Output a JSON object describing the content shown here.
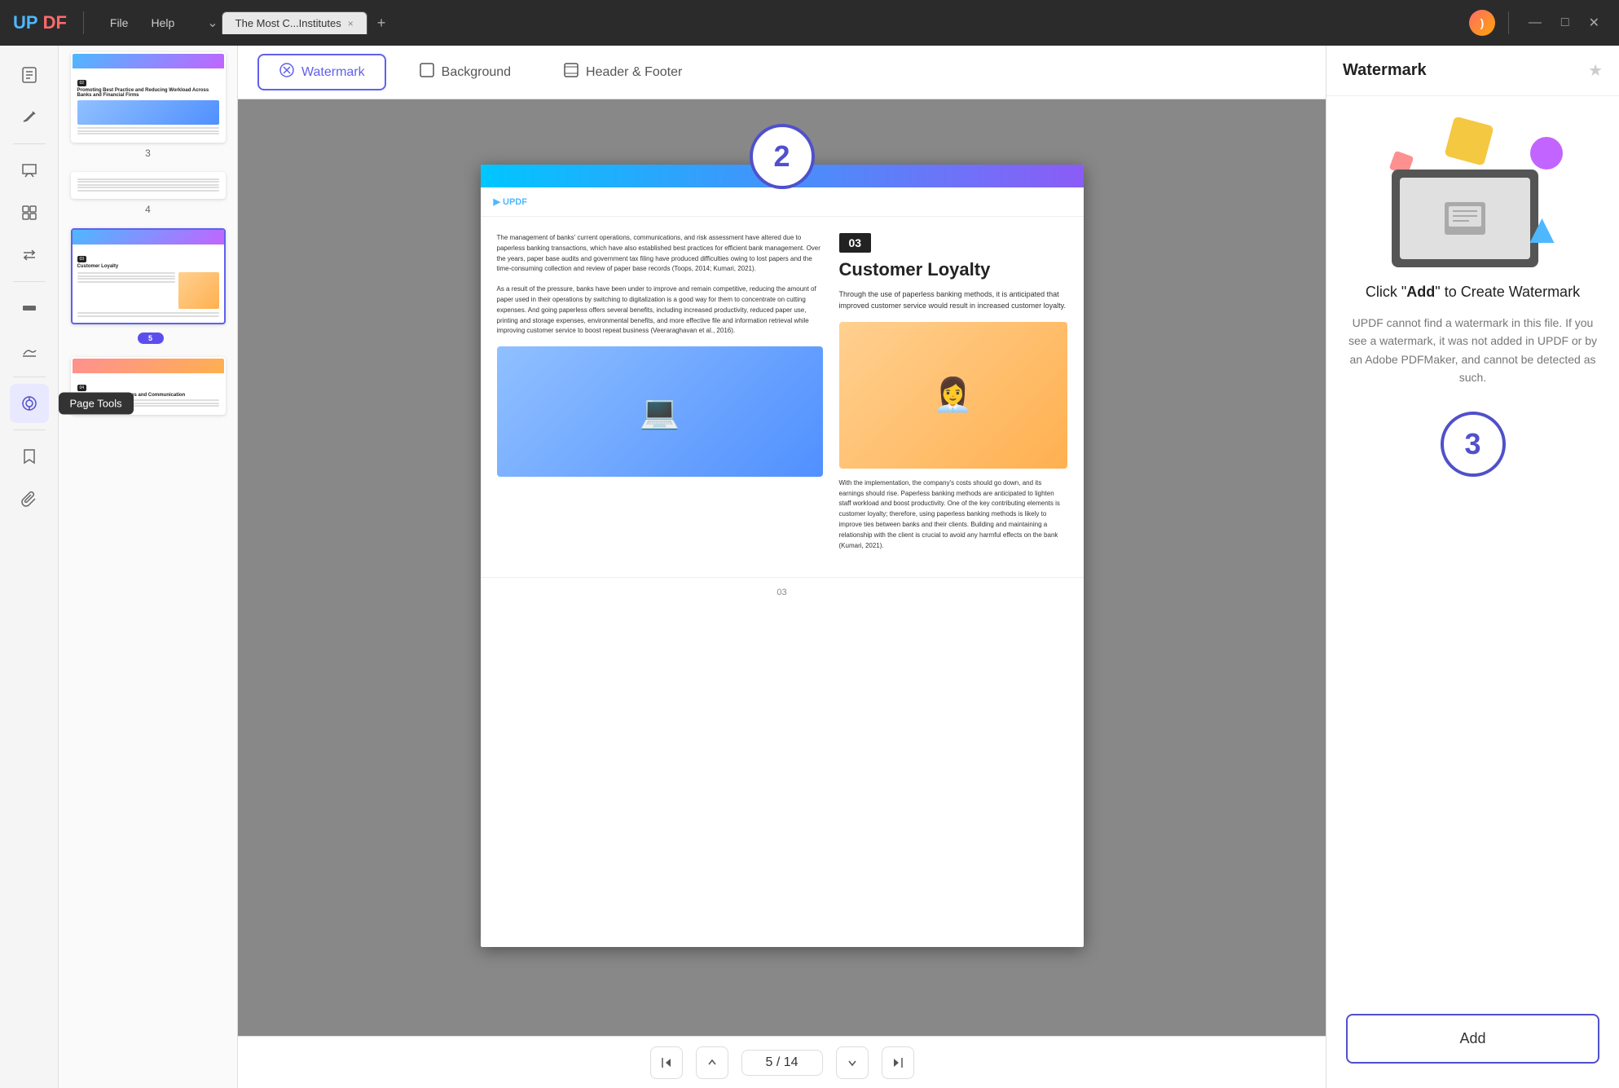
{
  "app": {
    "logo": "UPDF",
    "logo_up": "UP",
    "logo_df": "DF"
  },
  "titlebar": {
    "menu_file": "File",
    "menu_help": "Help",
    "tab_title": "The Most C...Institutes",
    "tab_close": "×",
    "tab_add": "+",
    "dropdown_icon": "⌄",
    "minimize": "—",
    "maximize": "□",
    "close": "✕"
  },
  "toolbar": {
    "items": [
      {
        "name": "reader-icon",
        "icon": "📖",
        "active": false
      },
      {
        "name": "edit-icon",
        "icon": "✏️",
        "active": false
      },
      {
        "name": "comment-icon",
        "icon": "💬",
        "active": false
      },
      {
        "name": "organize-icon",
        "icon": "⊞",
        "active": false
      },
      {
        "name": "convert-icon",
        "icon": "⇄",
        "active": false
      },
      {
        "name": "redact-icon",
        "icon": "▬",
        "active": false
      },
      {
        "name": "sign-icon",
        "icon": "✍️",
        "active": false
      },
      {
        "name": "layers-icon",
        "icon": "⊕",
        "active": true
      },
      {
        "name": "bookmark-icon",
        "icon": "🔖",
        "active": false
      },
      {
        "name": "paperclip-icon",
        "icon": "📎",
        "active": false
      }
    ],
    "page_tools_label": "Page Tools"
  },
  "page_tools_bar": {
    "tabs": [
      {
        "id": "watermark",
        "icon": "⊘",
        "label": "Watermark",
        "active": true
      },
      {
        "id": "background",
        "icon": "▣",
        "label": "Background",
        "active": false
      },
      {
        "id": "header_footer",
        "icon": "▤",
        "label": "Header & Footer",
        "active": false
      }
    ]
  },
  "thumbnails": [
    {
      "page_num": "3",
      "selected": false,
      "badge_text": "02",
      "title": "Promoting Best Practice and Reducing Workload Across Banks and Financial Firms"
    },
    {
      "page_num": "4",
      "selected": false,
      "badge_text": "",
      "title": ""
    },
    {
      "page_num": "5",
      "selected": true,
      "badge_text": "03",
      "title": "Customer Loyalty",
      "num_badge": "5"
    },
    {
      "page_num": "",
      "selected": false,
      "badge_text": "04",
      "title": "Better Customer Services and Communication"
    }
  ],
  "pdf_viewer": {
    "step_number": "2",
    "page": {
      "section_number": "03",
      "section_title": "Customer Loyalty",
      "body_text_1": "Through the use of paperless banking methods, it is anticipated that improved customer service would result in increased customer loyalty.",
      "body_text_2": "The management of banks' current operations, communications, and risk assessment have altered due to paperless banking transactions, which have also established best practices for efficient bank management. Over the years, paper base audits and government tax filing have produced difficulties owing to lost papers and the time-consuming collection and review of paper base records (Toops, 2014; Kumari, 2021).",
      "body_text_3": "As a result of the pressure, banks have been under to improve and remain competitive, reducing the amount of paper used in their operations by switching to digitalization is a good way for them to concentrate on cutting expenses. And going paperless offers several benefits, including increased productivity, reduced paper use, printing and storage expenses, environmental benefits, and more effective file and information retrieval while improving customer service to boost repeat business (Veeraraghavan et al., 2016).",
      "body_text_4": "With the implementation, the company's costs should go down, and its earnings should rise. Paperless banking methods are anticipated to lighten staff workload and boost productivity. One of the key contributing elements is customer loyalty; therefore, using paperless banking methods is likely to improve ties between banks and their clients. Building and maintaining a relationship with the client is crucial to avoid any harmful effects on the bank (Kumari, 2021).",
      "page_footer": "03"
    }
  },
  "navigation": {
    "first_page": "⇈",
    "prev_page": "↑",
    "current_page": "5",
    "separator": "/",
    "total_pages": "14",
    "next_page": "↓",
    "last_page": "⇊"
  },
  "right_panel": {
    "title": "Watermark",
    "star_icon": "★",
    "step_3_number": "3",
    "click_add_prefix": "Click \"",
    "click_add_strong": "Add",
    "click_add_suffix": "\" to Create Watermark",
    "info_text": "UPDF cannot find a watermark in this file. If you see a watermark, it was not added in UPDF or by an Adobe PDFMaker, and cannot be detected as such.",
    "add_button_label": "Add"
  }
}
